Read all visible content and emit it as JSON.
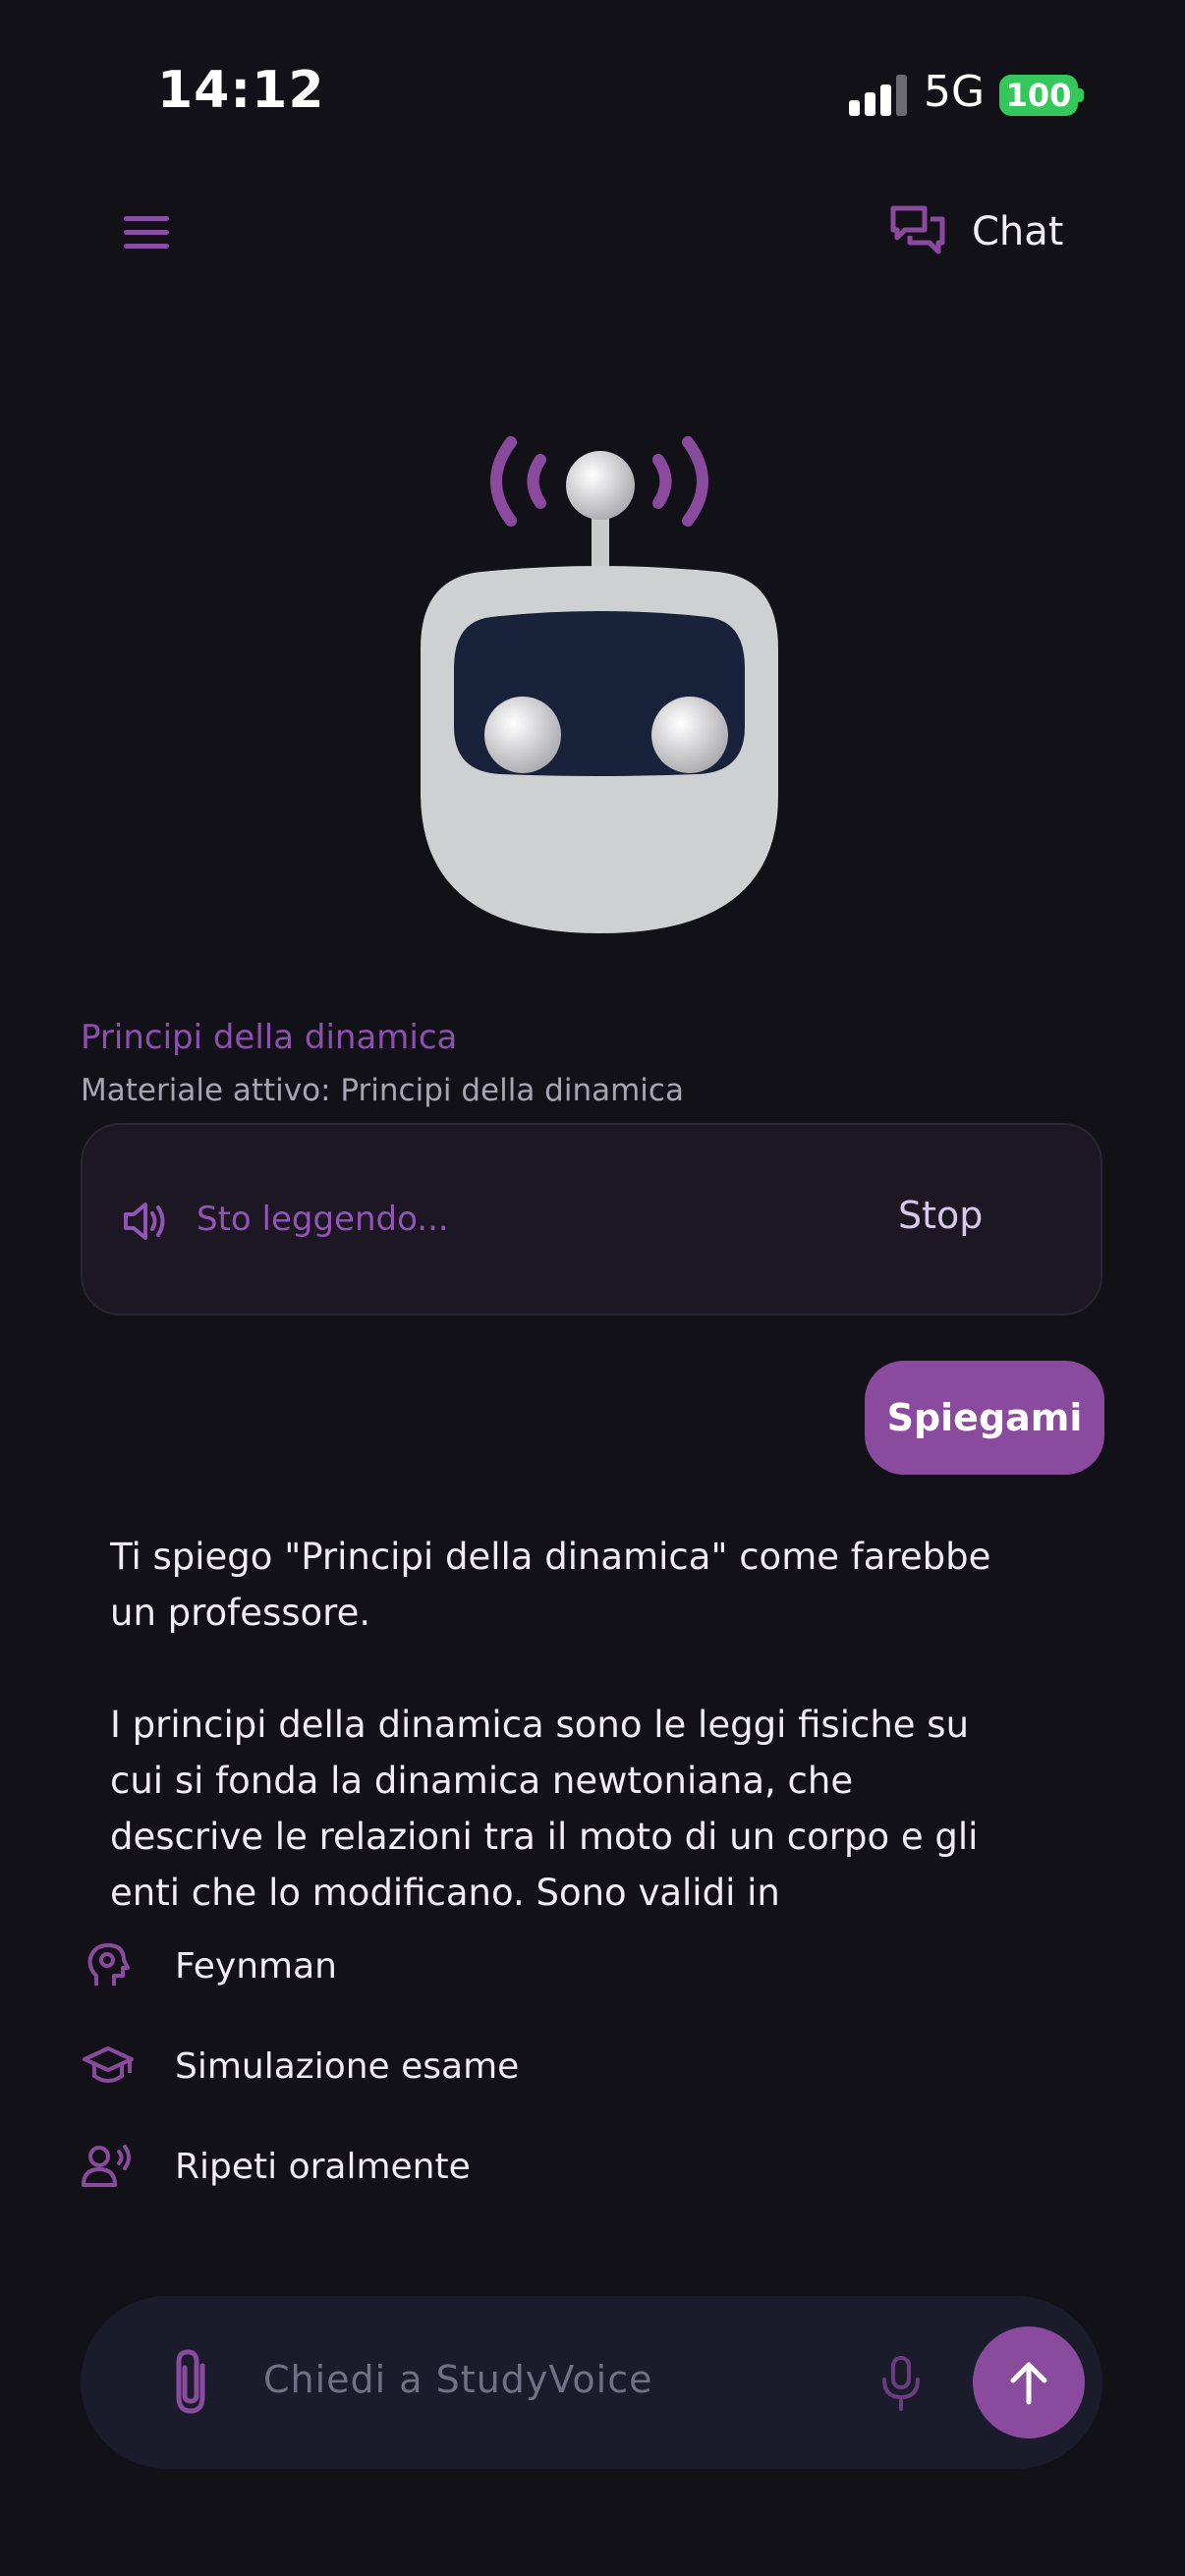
{
  "status_bar": {
    "time": "14:12",
    "network": "5G",
    "battery": "100"
  },
  "header": {
    "chat_label": "Chat"
  },
  "topic": {
    "title": "Principi della dinamica",
    "material": "Materiale attivo: Principi della dinamica"
  },
  "reading": {
    "status": "Sto leggendo...",
    "stop_label": "Stop"
  },
  "messages": {
    "user": "Spiegami",
    "assistant_p1": "Ti spiego \"Principi della dinamica\" come farebbe un professore.",
    "assistant_p2": "I principi della dinamica sono le leggi fisiche su cui si fonda la dinamica newtoniana, che descrive le relazioni tra il moto di un corpo e gli enti che lo modificano. Sono validi in"
  },
  "actions": [
    {
      "label": "Feynman",
      "icon": "brain-head-icon"
    },
    {
      "label": "Simulazione esame",
      "icon": "graduation-cap-icon"
    },
    {
      "label": "Ripeti oralmente",
      "icon": "speaking-person-icon"
    }
  ],
  "input": {
    "placeholder": "Chiedi a StudyVoice"
  },
  "colors": {
    "accent": "#8a4a9e",
    "background": "#131118",
    "card": "#1d1723",
    "input_bg": "#1a1c2c"
  }
}
